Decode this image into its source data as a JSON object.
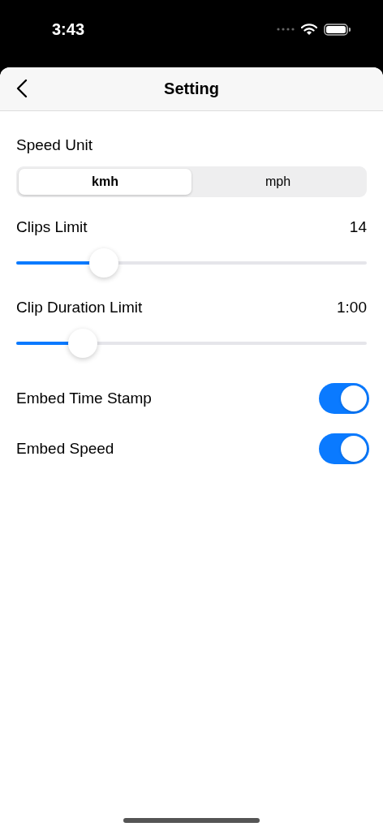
{
  "status_bar": {
    "time": "3:43"
  },
  "nav": {
    "title": "Setting"
  },
  "speed_unit": {
    "label": "Speed Unit",
    "options": [
      {
        "label": "kmh",
        "selected": true
      },
      {
        "label": "mph",
        "selected": false
      }
    ]
  },
  "sliders": [
    {
      "label": "Clips Limit",
      "reading": "14",
      "level": 0.25
    },
    {
      "label": "Clip Duration Limit",
      "reading": "1:00",
      "level": 0.19
    }
  ],
  "toggles": [
    {
      "label": "Embed Time Stamp",
      "on": true
    },
    {
      "label": "Embed Speed",
      "on": true
    }
  ]
}
